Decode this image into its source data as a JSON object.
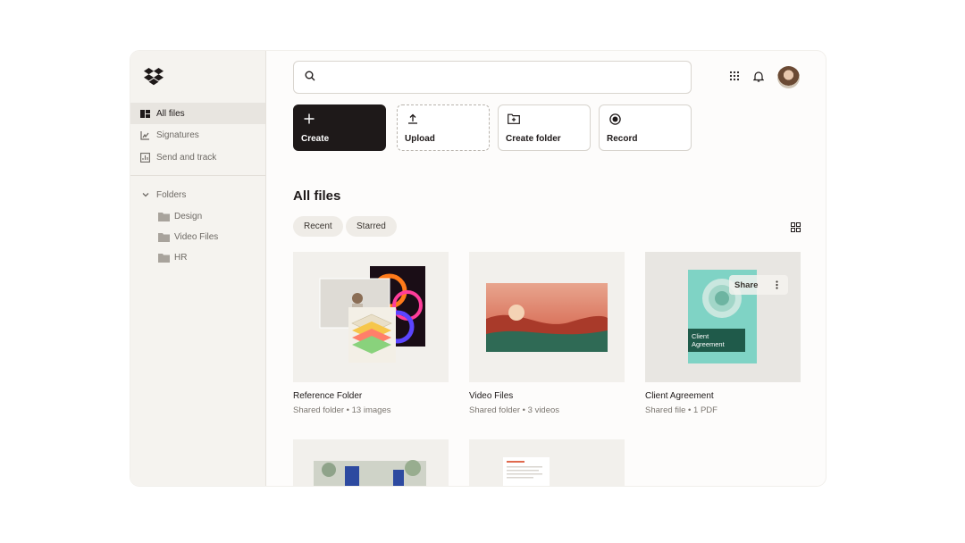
{
  "sidebar": {
    "logo": "dropbox-logo",
    "items": [
      {
        "label": "All files",
        "icon": "files-icon",
        "active": true
      },
      {
        "label": "Signatures",
        "icon": "signature-icon",
        "active": false
      },
      {
        "label": "Send and track",
        "icon": "chart-icon",
        "active": false
      }
    ],
    "folders_label": "Folders",
    "folders": [
      {
        "label": "Design"
      },
      {
        "label": "Video Files"
      },
      {
        "label": "HR"
      }
    ]
  },
  "search": {
    "placeholder": ""
  },
  "actions": [
    {
      "label": "Create",
      "icon": "plus-icon"
    },
    {
      "label": "Upload",
      "icon": "upload-icon"
    },
    {
      "label": "Create folder",
      "icon": "folder-plus-icon"
    },
    {
      "label": "Record",
      "icon": "record-icon"
    }
  ],
  "main": {
    "title": "All files",
    "chips": [
      "Recent",
      "Starred"
    ]
  },
  "files": [
    {
      "name": "Reference Folder",
      "meta": "Shared folder • 13 images"
    },
    {
      "name": "Video Files",
      "meta": "Shared folder • 3 videos"
    },
    {
      "name": "Client Agreement",
      "meta": "Shared file • 1 PDF",
      "share_label": "Share",
      "doc_title": "Client Agreement"
    }
  ],
  "colors": {
    "accent": "#1e1919",
    "sidebar_bg": "#f5f3ef",
    "teal": "#7fd3c5",
    "dark_green": "#1f5a4a"
  }
}
